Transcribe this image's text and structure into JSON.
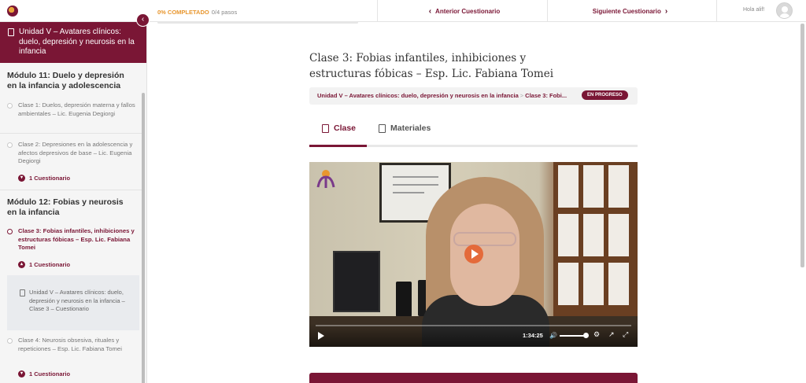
{
  "topbar": {
    "progress_label": "0% COMPLETADO",
    "progress_steps": "0/4 pasos",
    "progress_value": 0,
    "prev_label": "Anterior Cuestionario",
    "next_label": "Siguiente Cuestionario",
    "greeting": "Hola alif!"
  },
  "sidebar": {
    "unit_title": "Unidad V – Avatares clínicos: duelo, depresión y neurosis en la infancia",
    "modules": [
      {
        "title": "Módulo 11: Duelo y depresión en la infancia y adolescencia",
        "lessons": [
          {
            "title": "Clase 1: Duelos, depresión materna y fallos ambientales – Lic. Eugenia Degiorgi"
          },
          {
            "title": "Clase 2: Depresiones en la adolescencia y afectos depresivos de base – Lic. Eugenia Degiorgi",
            "quiz": "1 Cuestionario"
          }
        ]
      },
      {
        "title": "Módulo 12: Fobias y neurosis en la infancia",
        "lessons": [
          {
            "title": "Clase 3: Fobias infantiles, inhibiciones y estructuras fóbicas – Esp. Lic. Fabiana Tomei",
            "quiz": "1 Cuestionario",
            "quiz_item": "Unidad V – Avatares clínicos: duelo, depresión y neurosis en la infancia – Clase 3 – Cuestionario"
          },
          {
            "title": "Clase 4: Neurosis obsesiva, rituales y repeticiones – Esp. Lic. Fabiana Tomei",
            "quiz": "1 Cuestionario"
          }
        ]
      }
    ]
  },
  "main": {
    "title": "Clase 3: Fobias infantiles, inhibiciones y estructuras fóbicas – Esp. Lic. Fabiana Tomei",
    "breadcrumb_unit": "Unidad V – Avatares clínicos: duelo, depresión y neurosis en la infancia",
    "breadcrumb_sep": ">",
    "breadcrumb_lesson": "Clase 3: Fobi...",
    "status_badge": "EN PROGRESO",
    "tabs": [
      {
        "label": "Clase"
      },
      {
        "label": "Materiales"
      }
    ],
    "video": {
      "time": "1:34:25"
    }
  },
  "colors": {
    "brand": "#7a1635",
    "accent": "#e8962e",
    "play": "#e46a3a"
  }
}
